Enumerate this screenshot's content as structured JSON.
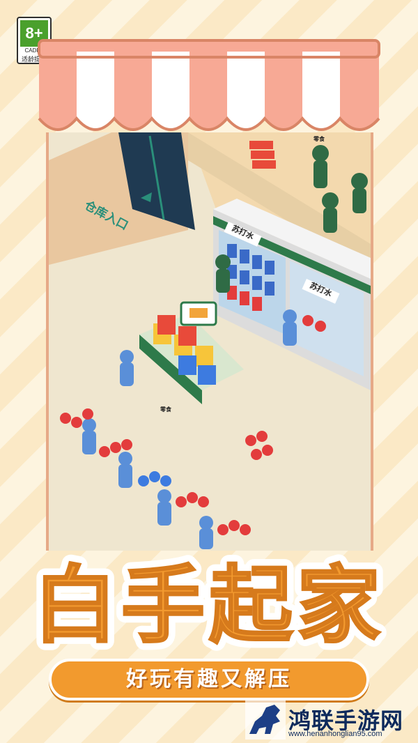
{
  "rating": {
    "age": "8+",
    "org": "CADPA",
    "note": "适龄提示"
  },
  "scene": {
    "warehouse_label": "仓库入口",
    "fridge_label_1": "苏打水",
    "fridge_label_2": "苏打水",
    "shelf_tag_1": "零食",
    "shelf_tag_2": "零食"
  },
  "title": {
    "line": "白手起家"
  },
  "banner": {
    "text": "好玩有趣又解压"
  },
  "brand": {
    "name": "鸿联手游网",
    "url": "www.henanhonglian95.com"
  },
  "colors": {
    "awning_red": "#f7a995",
    "banner_orange": "#f29a2e",
    "title_orange": "#f39a2f",
    "staff_green": "#2f6b45",
    "customer_blue": "#5a8fd8"
  }
}
